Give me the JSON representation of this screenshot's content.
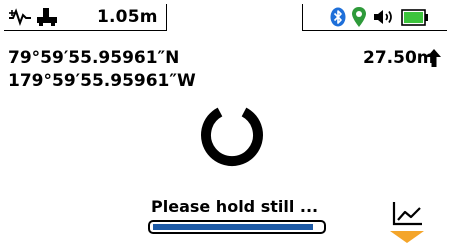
{
  "status": {
    "depth": "1.05m"
  },
  "location": {
    "latitude": "79°59′55.95961″N",
    "longitude": "179°59′55.95961″W",
    "height": "27.50m"
  },
  "message": {
    "text": "Please hold still ...",
    "progress": 0.95
  },
  "colors": {
    "bluetooth": "#1e6fd9",
    "gps": "#2e9a3a",
    "battery": "#3cc43c",
    "progress": "#1d5aa6",
    "softkey": "#f4a52a"
  },
  "icons": {
    "signal": "signal-mode-icon",
    "probe": "probe-icon",
    "bluetooth": "bluetooth-icon",
    "gps": "gps-pin-icon",
    "volume": "volume-icon",
    "battery": "battery-icon",
    "up": "up-arrow-icon",
    "spinner": "spinner-icon",
    "graph": "graph-icon"
  }
}
